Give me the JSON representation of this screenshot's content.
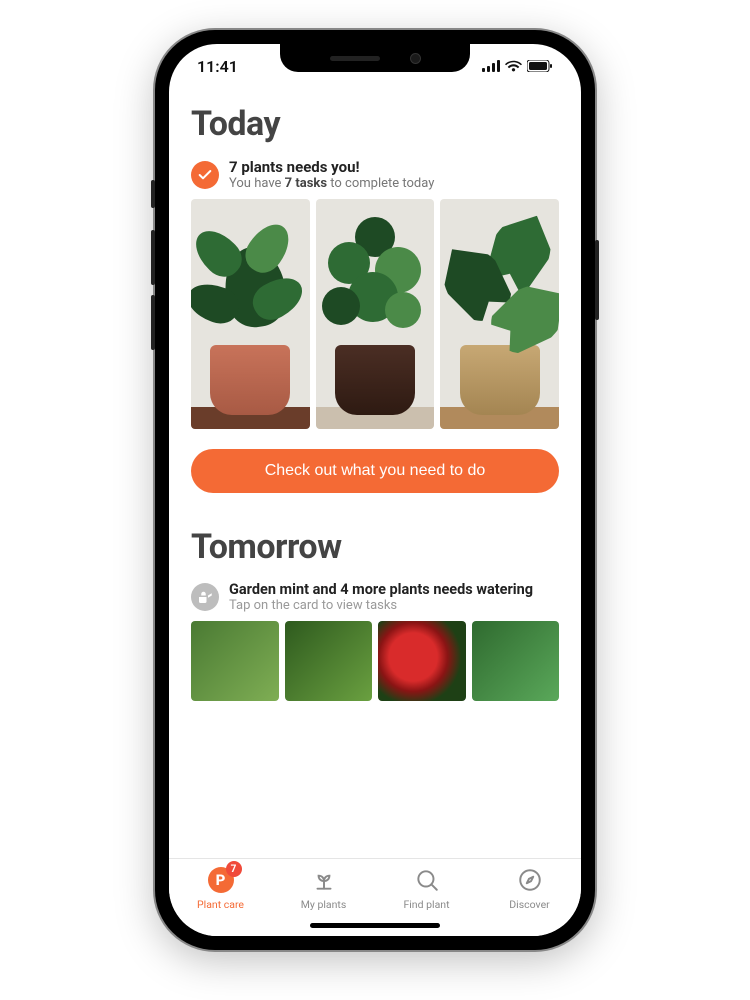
{
  "status": {
    "time": "11:41"
  },
  "today": {
    "heading": "Today",
    "title": "7 plants needs you!",
    "subtitle_prefix": "You have ",
    "subtitle_bold": "7 tasks",
    "subtitle_suffix": " to complete today",
    "cta": "Check out what you need to do"
  },
  "tomorrow": {
    "heading": "Tomorrow",
    "title": "Garden mint and 4 more plants needs watering",
    "subtitle": "Tap on the card to view tasks"
  },
  "tabs": [
    {
      "label": "Plant care",
      "badge": "7",
      "active": true
    },
    {
      "label": "My plants"
    },
    {
      "label": "Find plant"
    },
    {
      "label": "Discover"
    }
  ],
  "colors": {
    "accent": "#f46a35",
    "badge": "#f04a3a"
  }
}
